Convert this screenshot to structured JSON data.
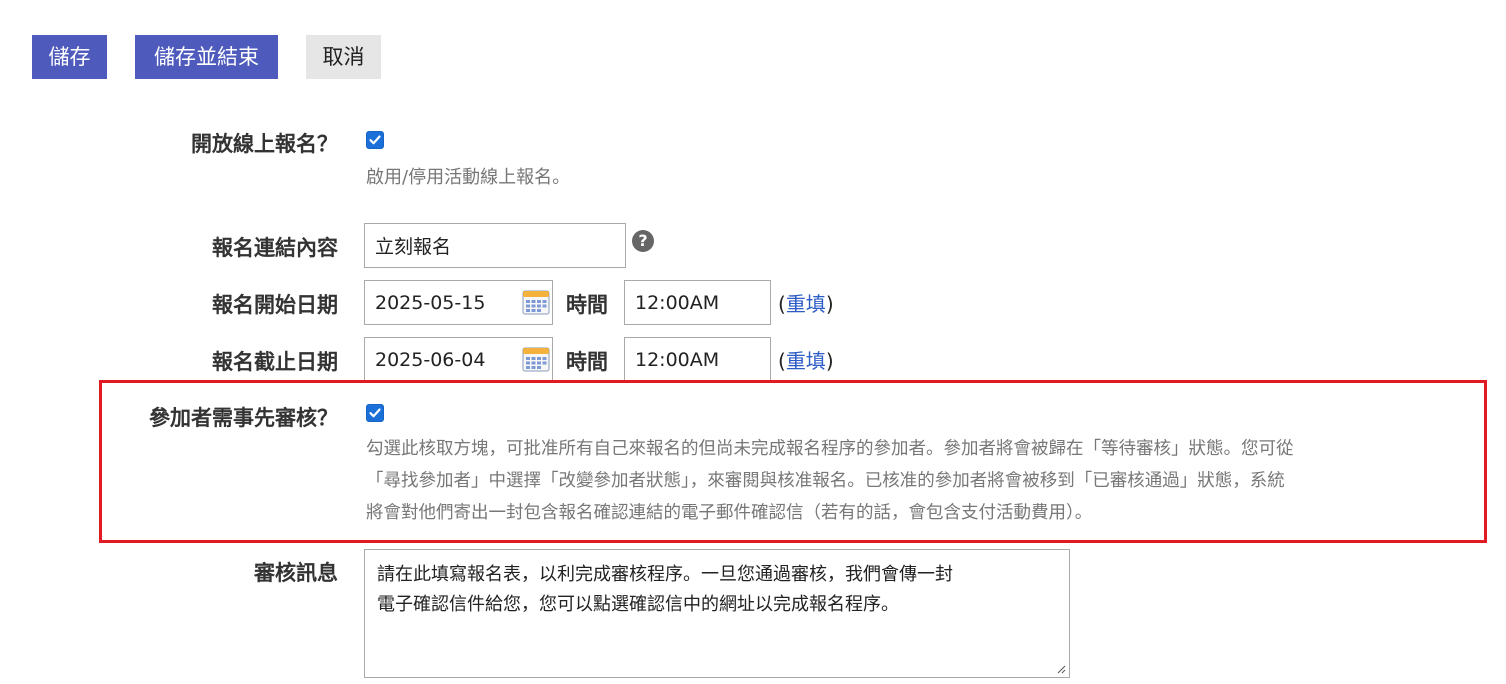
{
  "toolbar": {
    "save_label": "儲存",
    "save_close_label": "儲存並結束",
    "cancel_label": "取消"
  },
  "online_registration": {
    "label": "開放線上報名？",
    "checked": true,
    "help": "啟用/停用活動線上報名。"
  },
  "link_text": {
    "label": "報名連結內容",
    "value": "立刻報名",
    "help_icon": "question-circle-icon"
  },
  "start": {
    "label": "報名開始日期",
    "date": "2025-05-15",
    "time_label": "時間",
    "time": "12:00AM",
    "reset_prefix": "(",
    "reset_label": "重填",
    "reset_suffix": ")"
  },
  "end": {
    "label": "報名截止日期",
    "date": "2025-06-04",
    "time_label": "時間",
    "time": "12:00AM",
    "reset_prefix": "(",
    "reset_label": "重填",
    "reset_suffix": ")"
  },
  "approval": {
    "label": "參加者需事先審核？",
    "checked": true,
    "help_line1": "勾選此核取方塊，可批准所有自己來報名的但尚未完成報名程序的參加者。參加者將會被歸在「等待審核」狀態。您可從",
    "help_line2": "「尋找參加者」中選擇「改變參加者狀態」，來審閱與核准報名。已核准的參加者將會被移到「已審核通過」狀態，系統",
    "help_line3": "將會對他們寄出一封包含報名確認連結的電子郵件確認信（若有的話，會包含支付活動費用）。"
  },
  "approval_message": {
    "label": "審核訊息",
    "value": "請在此填寫報名表，以利完成審核程序。一旦您通過審核，我們會傳一封\n電子確認信件給您，您可以點選確認信中的網址以完成報名程序。"
  },
  "colors": {
    "primary": "#4e5bbd",
    "highlight_border": "#e01b24",
    "link": "#2c5cc5",
    "checkbox": "#1a6fd8"
  }
}
